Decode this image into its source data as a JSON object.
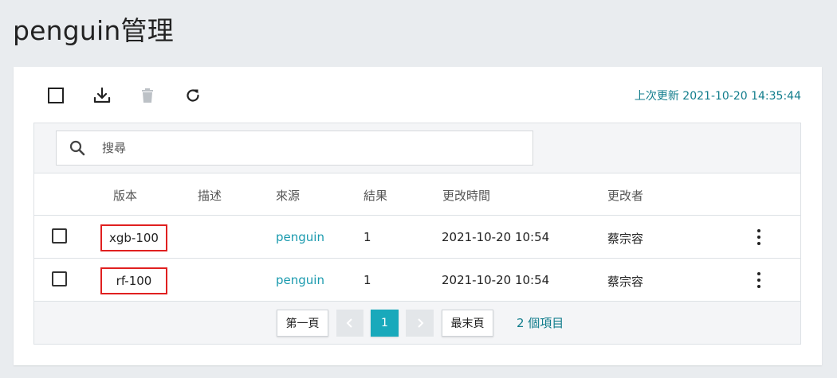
{
  "page": {
    "title": "penguin管理"
  },
  "toolbar": {
    "last_updated": "上次更新 2021-10-20 14:35:44",
    "icons": [
      "checkbox-icon",
      "download-icon",
      "trash-icon",
      "refresh-icon"
    ]
  },
  "search": {
    "placeholder": "搜尋"
  },
  "table": {
    "headers": {
      "version": "版本",
      "description": "描述",
      "source": "來源",
      "result": "結果",
      "modified_time": "更改時間",
      "modified_by": "更改者"
    },
    "rows": [
      {
        "version": "xgb-100",
        "description": "",
        "source": "penguin",
        "result": "1",
        "modified_time": "2021-10-20 10:54",
        "modified_by": "蔡宗容"
      },
      {
        "version": "rf-100",
        "description": "",
        "source": "penguin",
        "result": "1",
        "modified_time": "2021-10-20 10:54",
        "modified_by": "蔡宗容"
      }
    ]
  },
  "pagination": {
    "first": "第一頁",
    "current": "1",
    "last": "最末頁",
    "count": "2 個項目"
  },
  "colors": {
    "accent": "#19a9bb",
    "link": "#1a9aae",
    "highlight_border": "#e02020",
    "updated_text": "#127d8c"
  }
}
